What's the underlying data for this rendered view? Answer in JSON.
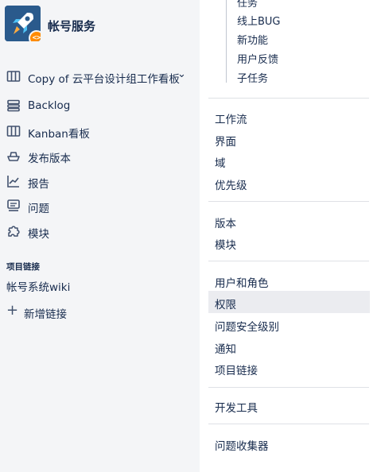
{
  "project": {
    "name": "帐号服务",
    "badge_icon": "code-icon",
    "avatar_icon": "rocket-icon"
  },
  "board_switcher": {
    "label": "Copy of 云平台设计组工作看板",
    "icon": "board-icon"
  },
  "nav": {
    "items": [
      {
        "label": "Backlog",
        "icon": "backlog-icon"
      },
      {
        "label": "Kanban看板",
        "icon": "kanban-icon"
      },
      {
        "label": "发布版本",
        "icon": "ship-icon"
      },
      {
        "label": "报告",
        "icon": "reports-icon"
      },
      {
        "label": "问题",
        "icon": "issues-icon"
      },
      {
        "label": "模块",
        "icon": "components-icon"
      }
    ]
  },
  "project_links": {
    "title": "项目链接",
    "items": [
      "帐号系统wiki"
    ],
    "add_label": "新增链接"
  },
  "settings": {
    "issue_types": [
      "任务",
      "线上BUG",
      "新功能",
      "用户反馈",
      "子任务"
    ],
    "group1": [
      "工作流",
      "界面",
      "域",
      "优先级"
    ],
    "group2": [
      "版本",
      "模块"
    ],
    "group3": [
      "用户和角色",
      "权限",
      "问题安全级别",
      "通知",
      "项目链接"
    ],
    "group4": [
      "开发工具"
    ],
    "group5": [
      "问题收集器"
    ]
  },
  "colors": {
    "sidebar_bg": "#f4f5f7",
    "active_bg": "#ebecf0",
    "text": "#172b4d",
    "badge": "#ff8b00",
    "avatar": "#2a5a8c"
  }
}
